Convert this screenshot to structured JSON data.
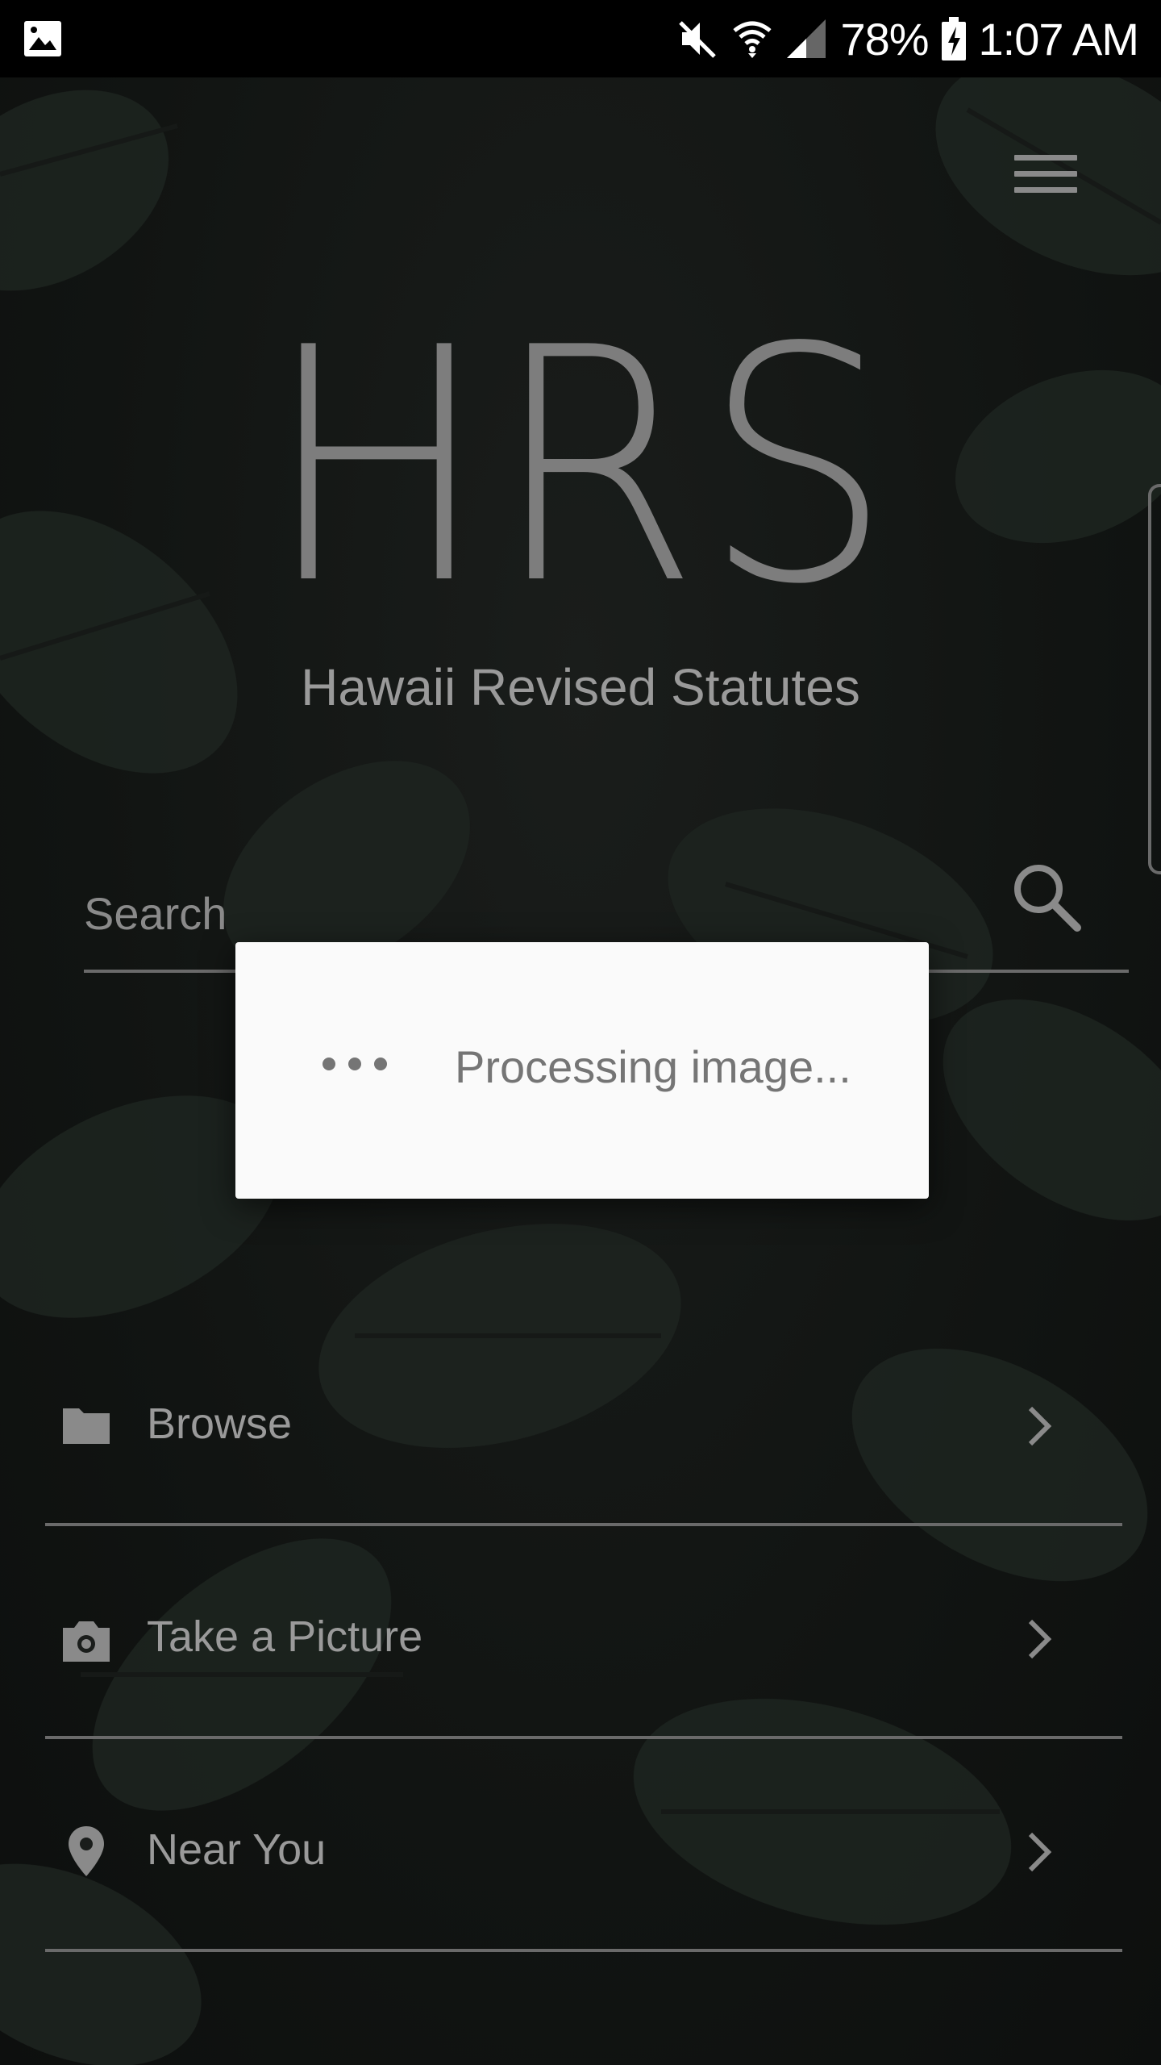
{
  "status_bar": {
    "battery": "78%",
    "time": "1:07 AM",
    "icons": [
      "image-icon",
      "mute-icon",
      "wifi-icon",
      "signal-icon",
      "battery-charging-icon"
    ]
  },
  "header": {
    "menu_icon": "hamburger-menu-icon",
    "logo": "HRS",
    "subtitle": "Hawaii Revised Statutes"
  },
  "search": {
    "placeholder": "Search",
    "icon": "search-icon"
  },
  "dialog": {
    "message": "Processing image..."
  },
  "nav": {
    "items": [
      {
        "label": "Browse",
        "icon": "folder-icon"
      },
      {
        "label": "Take a Picture",
        "icon": "camera-icon"
      },
      {
        "label": "Near You",
        "icon": "location-pin-icon"
      }
    ]
  },
  "colors": {
    "background": "#111412",
    "text_muted": "#9a9a9a",
    "dialog_bg": "#fafafa",
    "dialog_text": "#757575"
  }
}
